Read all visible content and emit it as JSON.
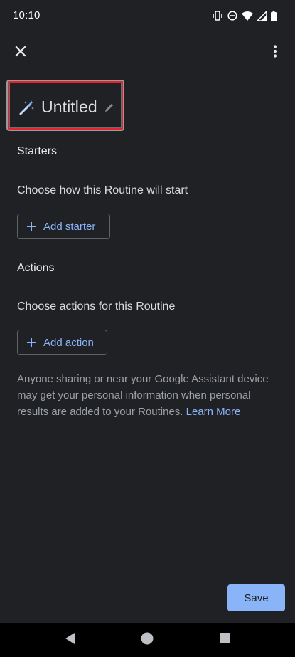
{
  "status_bar": {
    "time": "10:10",
    "icons": [
      "vibrate-icon",
      "do-not-disturb-icon",
      "wifi-icon",
      "signal-icon",
      "battery-icon"
    ]
  },
  "toolbar": {
    "close_icon": "close-icon",
    "more_icon": "more-vert-icon"
  },
  "routine": {
    "title": "Untitled",
    "title_icon": "magic-wand-icon",
    "edit_icon": "pencil-icon"
  },
  "starters": {
    "heading": "Starters",
    "description": "Choose how this Routine will start",
    "button_label": "Add starter"
  },
  "actions": {
    "heading": "Actions",
    "description": "Choose actions for this Routine",
    "button_label": "Add action"
  },
  "info": {
    "text": "Anyone sharing or near your Google Assistant device may get your personal information when personal results are added to your Routines.",
    "link": "Learn More"
  },
  "footer": {
    "save_label": "Save"
  },
  "nav_bar": {
    "items": [
      "back-icon",
      "home-icon",
      "recents-icon"
    ]
  },
  "colors": {
    "background": "#202124",
    "accent": "#8ab4f8",
    "highlight_border": "#e8222f"
  }
}
